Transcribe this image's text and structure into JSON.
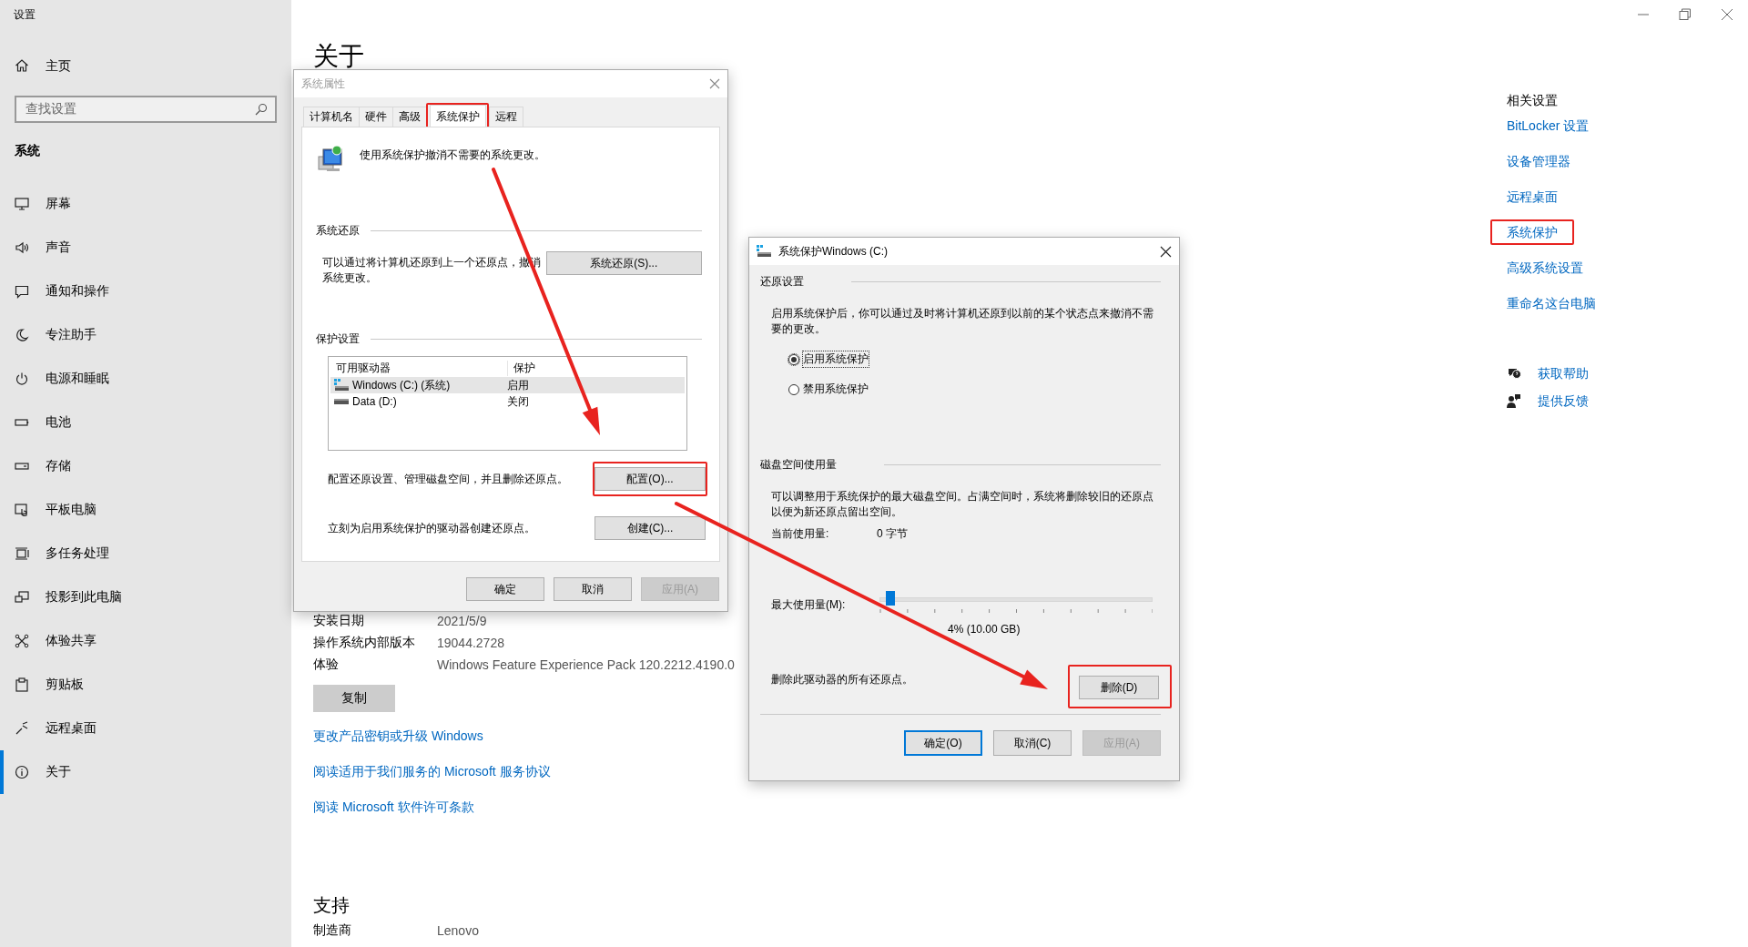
{
  "window": {
    "title": "设置"
  },
  "sidebar": {
    "home": "主页",
    "search_placeholder": "查找设置",
    "section": "系统",
    "items": [
      {
        "label": "屏幕",
        "selected": false
      },
      {
        "label": "声音",
        "selected": false
      },
      {
        "label": "通知和操作",
        "selected": false
      },
      {
        "label": "专注助手",
        "selected": false
      },
      {
        "label": "电源和睡眠",
        "selected": false
      },
      {
        "label": "电池",
        "selected": false
      },
      {
        "label": "存储",
        "selected": false
      },
      {
        "label": "平板电脑",
        "selected": false
      },
      {
        "label": "多任务处理",
        "selected": false
      },
      {
        "label": "投影到此电脑",
        "selected": false
      },
      {
        "label": "体验共享",
        "selected": false
      },
      {
        "label": "剪贴板",
        "selected": false
      },
      {
        "label": "远程桌面",
        "selected": false
      },
      {
        "label": "关于",
        "selected": true
      }
    ]
  },
  "about": {
    "heading": "关于",
    "specs": [
      {
        "label": "安装日期",
        "value": "2021/5/9"
      },
      {
        "label": "操作系统内部版本",
        "value": "19044.2728"
      },
      {
        "label": "体验",
        "value": "Windows Feature Experience Pack 120.2212.4190.0"
      }
    ],
    "copy_button": "复制",
    "links": [
      "更改产品密钥或升级 Windows",
      "阅读适用于我们服务的 Microsoft 服务协议",
      "阅读 Microsoft 软件许可条款"
    ],
    "support_heading": "支持",
    "support_specs": [
      {
        "label": "制造商",
        "value": "Lenovo"
      }
    ]
  },
  "related": {
    "heading": "相关设置",
    "links": [
      {
        "label": "BitLocker 设置",
        "highlighted": false
      },
      {
        "label": "设备管理器",
        "highlighted": false
      },
      {
        "label": "远程桌面",
        "highlighted": false
      },
      {
        "label": "系统保护",
        "highlighted": true
      },
      {
        "label": "高级系统设置",
        "highlighted": false
      },
      {
        "label": "重命名这台电脑",
        "highlighted": false
      }
    ],
    "help": [
      "获取帮助",
      "提供反馈"
    ]
  },
  "system_properties": {
    "title": "系统属性",
    "tabs": [
      {
        "label": "计算机名",
        "selected": false,
        "highlighted": false
      },
      {
        "label": "硬件",
        "selected": false,
        "highlighted": false
      },
      {
        "label": "高级",
        "selected": false,
        "highlighted": false
      },
      {
        "label": "系统保护",
        "selected": true,
        "highlighted": true
      },
      {
        "label": "远程",
        "selected": false,
        "highlighted": false
      }
    ],
    "intro": "使用系统保护撤消不需要的系统更改。",
    "restore_heading": "系统还原",
    "restore_text": "可以通过将计算机还原到上一个还原点，撤消系统更改。",
    "restore_button": "系统还原(S)...",
    "protection_heading": "保护设置",
    "columns": [
      "可用驱动器",
      "保护"
    ],
    "drives": [
      {
        "name": "Windows (C:) (系统)",
        "status": "启用",
        "kind": "system",
        "selected": true
      },
      {
        "name": "Data (D:)",
        "status": "关闭",
        "kind": "data",
        "selected": false
      }
    ],
    "configure_text": "配置还原设置、管理磁盘空间，并且删除还原点。",
    "configure_button": {
      "label": "配置(O)...",
      "highlighted": true
    },
    "create_text": "立刻为启用系统保护的驱动器创建还原点。",
    "create_button": "创建(C)...",
    "buttons": [
      {
        "label": "确定",
        "disabled": false
      },
      {
        "label": "取消",
        "disabled": false
      },
      {
        "label": "应用(A)",
        "disabled": true
      }
    ]
  },
  "protection_dialog": {
    "title": "系统保护Windows (C:)",
    "restore_heading": "还原设置",
    "restore_text": "启用系统保护后，你可以通过及时将计算机还原到以前的某个状态点来撤消不需要的更改。",
    "options": [
      {
        "label": "启用系统保护",
        "selected": true
      },
      {
        "label": "禁用系统保护",
        "selected": false
      }
    ],
    "disk_heading": "磁盘空间使用量",
    "disk_text": "可以调整用于系统保护的最大磁盘空间。占满空间时，系统将删除较旧的还原点以便为新还原点留出空间。",
    "current_label": "当前使用量:",
    "current_value": "0 字节",
    "max_label": "最大使用量(M):",
    "max_usage": {
      "level": 0.04
    },
    "max_reading": "4% (10.00 GB)",
    "delete_text": "删除此驱动器的所有还原点。",
    "delete_button": {
      "label": "删除(D)",
      "highlighted": true
    },
    "buttons": [
      {
        "label": "确定(O)",
        "default": true,
        "disabled": false
      },
      {
        "label": "取消(C)",
        "default": false,
        "disabled": false
      },
      {
        "label": "应用(A)",
        "default": false,
        "disabled": true
      }
    ]
  }
}
